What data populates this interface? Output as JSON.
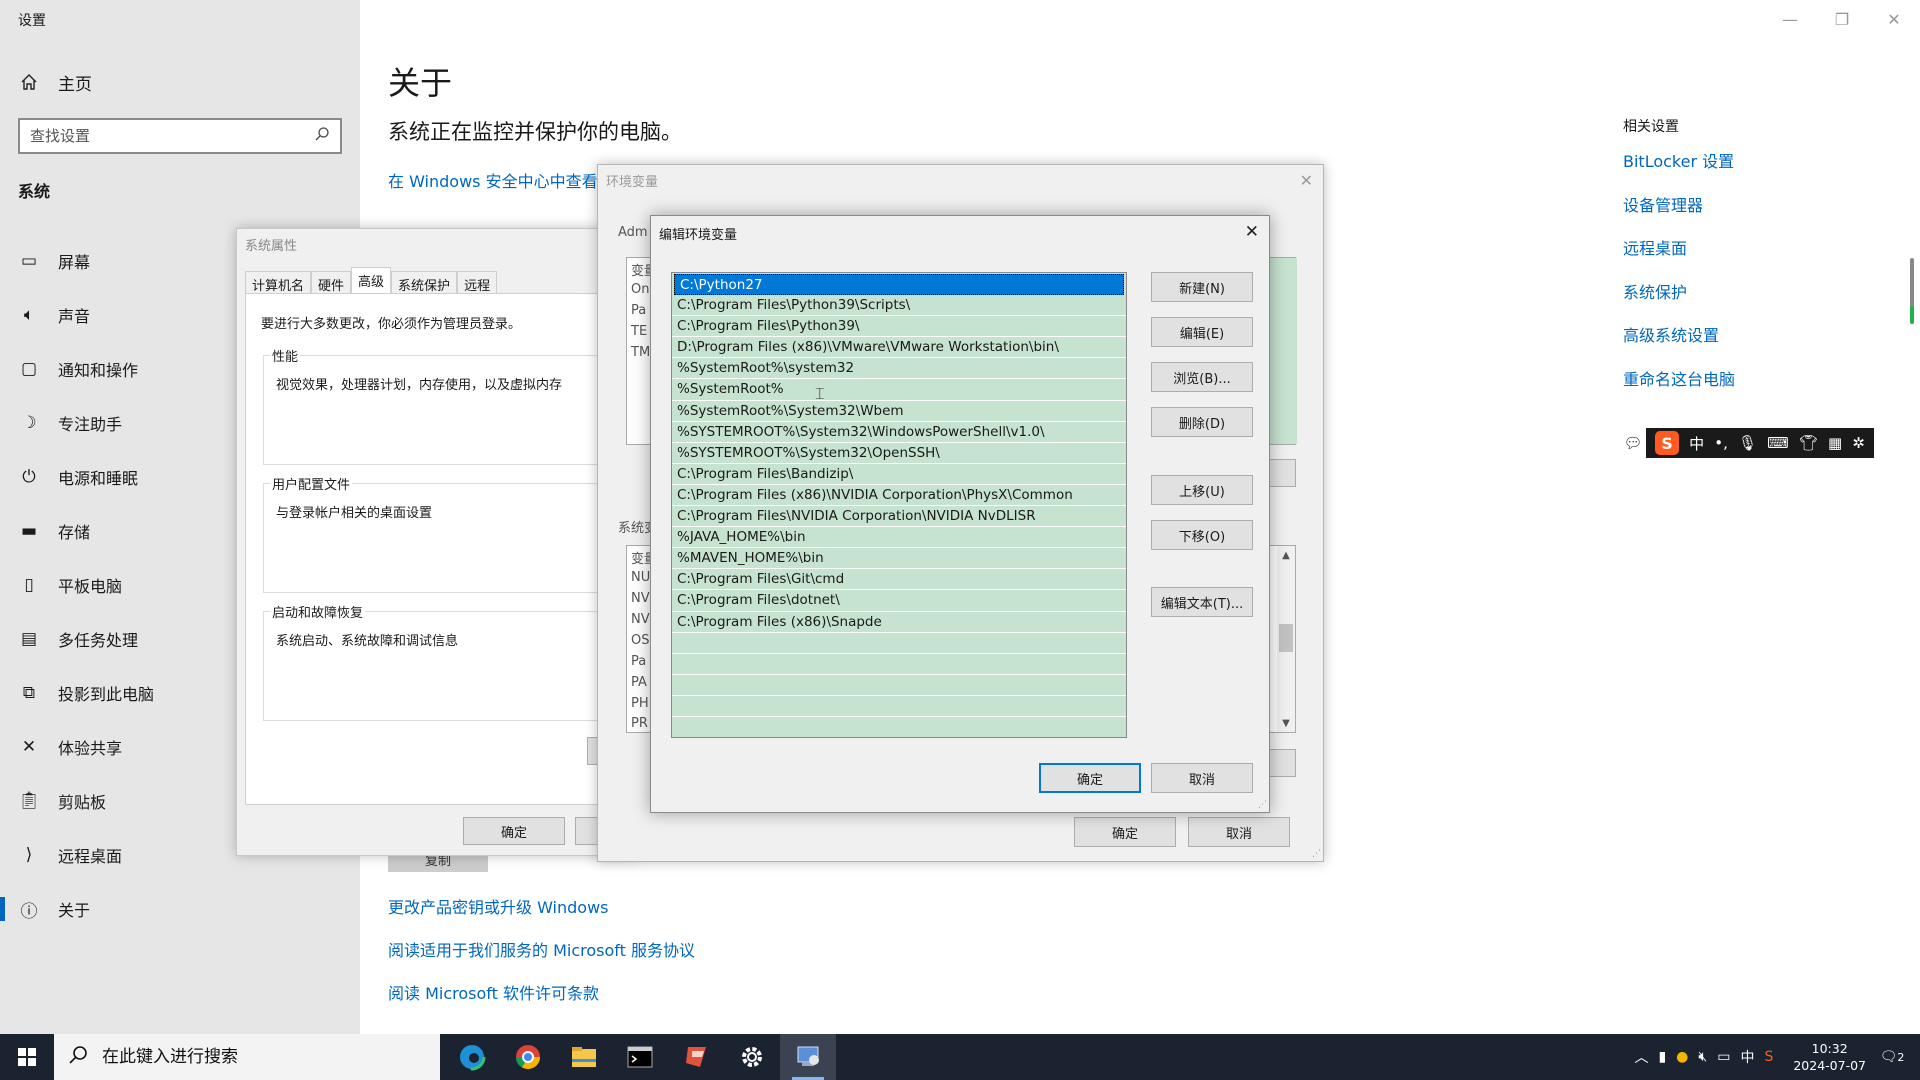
{
  "settings": {
    "app_title": "设置",
    "home_label": "主页",
    "search_placeholder": "查找设置",
    "section_label": "系统",
    "nav": [
      {
        "label": "屏幕",
        "icon": "monitor-icon"
      },
      {
        "label": "声音",
        "icon": "speaker-icon"
      },
      {
        "label": "通知和操作",
        "icon": "notification-icon"
      },
      {
        "label": "专注助手",
        "icon": "moon-icon"
      },
      {
        "label": "电源和睡眠",
        "icon": "power-icon"
      },
      {
        "label": "存储",
        "icon": "storage-icon"
      },
      {
        "label": "平板电脑",
        "icon": "tablet-icon"
      },
      {
        "label": "多任务处理",
        "icon": "multitask-icon"
      },
      {
        "label": "投影到此电脑",
        "icon": "project-icon"
      },
      {
        "label": "体验共享",
        "icon": "share-icon"
      },
      {
        "label": "剪贴板",
        "icon": "clipboard-icon"
      },
      {
        "label": "远程桌面",
        "icon": "remote-icon"
      },
      {
        "label": "关于",
        "icon": "info-icon"
      }
    ],
    "page_title": "关于",
    "page_subtitle": "系统正在监控并保护你的电脑。",
    "security_link": "在 Windows 安全中心中查看详",
    "copy_button": "复制",
    "bottom_links": [
      "更改产品密钥或升级 Windows",
      "阅读适用于我们服务的 Microsoft 服务协议",
      "阅读 Microsoft 软件许可条款"
    ],
    "related_title": "相关设置",
    "related_links": [
      "BitLocker 设置",
      "设备管理器",
      "远程桌面",
      "系统保护",
      "高级系统设置",
      "重命名这台电脑"
    ],
    "accent_color": "#0067c0"
  },
  "ime": {
    "logo": "S",
    "mode": "中",
    "punct": "•,"
  },
  "system_properties": {
    "title": "系统属性",
    "tabs": [
      "计算机名",
      "硬件",
      "高级",
      "系统保护",
      "远程"
    ],
    "active_tab": 2,
    "admin_note": "要进行大多数更改，你必须作为管理员登录。",
    "groups": [
      {
        "label": "性能",
        "text": "视觉效果，处理器计划，内存使用，以及虚拟内存"
      },
      {
        "label": "用户配置文件",
        "text": "与登录帐户相关的桌面设置"
      },
      {
        "label": "启动和故障恢复",
        "text": "系统启动、系统故障和调试信息"
      }
    ],
    "ok_button": "确定"
  },
  "env_vars": {
    "title": "环境变量",
    "user_label": "Adm",
    "user_col": "变量",
    "user_rows": [
      "On",
      "Pa",
      "TE",
      "TM"
    ],
    "sys_label": "系统变",
    "sys_col": "变量",
    "sys_rows": [
      "NU",
      "NV",
      "NV",
      "OS",
      "Pa",
      "PA",
      "PH",
      "PR"
    ],
    "ok_button": "确定",
    "cancel_button": "取消"
  },
  "edit_env": {
    "title": "编辑环境变量",
    "paths": [
      "C:\\Python27",
      "C:\\Program Files\\Python39\\Scripts\\",
      "C:\\Program Files\\Python39\\",
      "D:\\Program Files (x86)\\VMware\\VMware Workstation\\bin\\",
      "%SystemRoot%\\system32",
      "%SystemRoot%",
      "%SystemRoot%\\System32\\Wbem",
      "%SYSTEMROOT%\\System32\\WindowsPowerShell\\v1.0\\",
      "%SYSTEMROOT%\\System32\\OpenSSH\\",
      "C:\\Program Files\\Bandizip\\",
      "C:\\Program Files (x86)\\NVIDIA Corporation\\PhysX\\Common",
      "C:\\Program Files\\NVIDIA Corporation\\NVIDIA NvDLISR",
      "%JAVA_HOME%\\bin",
      "%MAVEN_HOME%\\bin",
      "C:\\Program Files\\Git\\cmd",
      "C:\\Program Files\\dotnet\\",
      "C:\\Program Files (x86)\\Snapde"
    ],
    "selected_index": 0,
    "buttons": {
      "new": "新建(N)",
      "edit": "编辑(E)",
      "browse": "浏览(B)...",
      "delete": "删除(D)",
      "move_up": "上移(U)",
      "move_down": "下移(O)",
      "edit_text": "编辑文本(T)..."
    },
    "ok_button": "确定",
    "cancel_button": "取消",
    "list_color": "#c6e3cf",
    "selection_color": "#0078d7"
  },
  "taskbar": {
    "search_placeholder": "在此键入进行搜索",
    "apps": [
      "edge-icon",
      "chrome-icon",
      "file-explorer-icon",
      "terminal-icon",
      "powerpoint-icon",
      "settings-icon",
      "control-panel-icon"
    ],
    "tray_lang": "中",
    "time": "10:32",
    "date": "2024-07-07",
    "notifications": "2"
  }
}
